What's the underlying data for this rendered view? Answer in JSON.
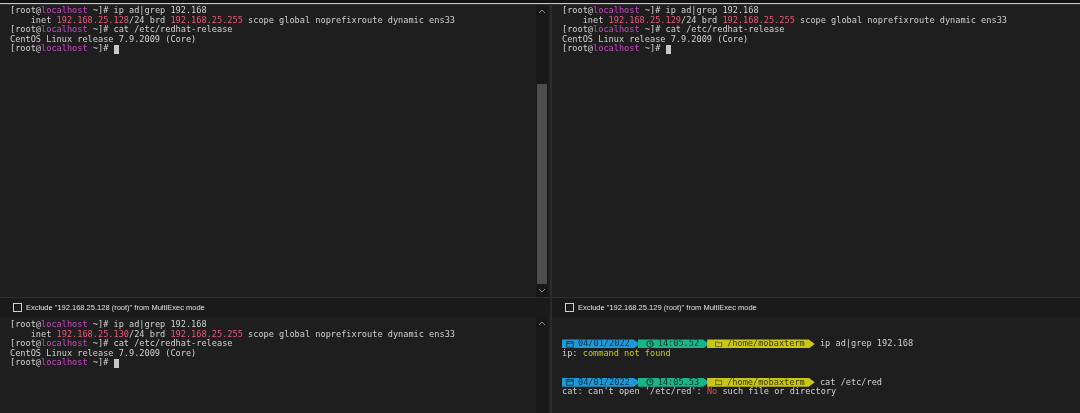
{
  "panes": [
    {
      "lines": [
        [
          {
            "kind": "plain",
            "text": "[root@"
          },
          {
            "kind": "host",
            "text": "localhost"
          },
          {
            "kind": "plain",
            "text": " ~]# ip ad|grep 192.168"
          }
        ],
        [
          {
            "kind": "plain",
            "text": "    inet "
          },
          {
            "kind": "ip",
            "text": "192.168.25.128"
          },
          {
            "kind": "plain",
            "text": "/24 brd "
          },
          {
            "kind": "ip",
            "text": "192.168.25.255"
          },
          {
            "kind": "plain",
            "text": " scope global noprefixroute dynamic ens33"
          }
        ],
        [
          {
            "kind": "plain",
            "text": "[root@"
          },
          {
            "kind": "host",
            "text": "localhost"
          },
          {
            "kind": "plain",
            "text": " ~]# cat /etc/redhat-release"
          }
        ],
        [
          {
            "kind": "plain",
            "text": "CentOS Linux release 7.9.2009 (Core)"
          }
        ],
        [
          {
            "kind": "plain",
            "text": "[root@"
          },
          {
            "kind": "host",
            "text": "localhost"
          },
          {
            "kind": "plain",
            "text": " ~]# "
          }
        ]
      ],
      "cursor": true,
      "scrollbar": true,
      "exclude": {
        "label": "Exclude \"192.168.25.128 (root)\" from MultiExec mode",
        "checked": false
      }
    },
    {
      "lines": [
        [
          {
            "kind": "plain",
            "text": "[root@"
          },
          {
            "kind": "host",
            "text": "localhost"
          },
          {
            "kind": "plain",
            "text": " ~]# ip ad|grep 192.168"
          }
        ],
        [
          {
            "kind": "plain",
            "text": "    inet "
          },
          {
            "kind": "ip",
            "text": "192.168.25.129"
          },
          {
            "kind": "plain",
            "text": "/24 brd "
          },
          {
            "kind": "ip",
            "text": "192.168.25.255"
          },
          {
            "kind": "plain",
            "text": " scope global noprefixroute dynamic ens33"
          }
        ],
        [
          {
            "kind": "plain",
            "text": "[root@"
          },
          {
            "kind": "host",
            "text": "localhost"
          },
          {
            "kind": "plain",
            "text": " ~]# cat /etc/redhat-release"
          }
        ],
        [
          {
            "kind": "plain",
            "text": "CentOS Linux release 7.9.2009 (Core)"
          }
        ],
        [
          {
            "kind": "plain",
            "text": "[root@"
          },
          {
            "kind": "host",
            "text": "localhost"
          },
          {
            "kind": "plain",
            "text": " ~]# "
          }
        ]
      ],
      "cursor": true,
      "scrollbar": false,
      "exclude": {
        "label": "Exclude \"192.168.25.129 (root)\" from MultiExec mode",
        "checked": false
      }
    },
    {
      "lines": [
        [
          {
            "kind": "plain",
            "text": "[root@"
          },
          {
            "kind": "host",
            "text": "localhost"
          },
          {
            "kind": "plain",
            "text": " ~]# ip ad|grep 192.168"
          }
        ],
        [
          {
            "kind": "plain",
            "text": "    inet "
          },
          {
            "kind": "ip",
            "text": "192.168.25.130"
          },
          {
            "kind": "plain",
            "text": "/24 brd "
          },
          {
            "kind": "ip",
            "text": "192.168.25.255"
          },
          {
            "kind": "plain",
            "text": " scope global noprefixroute dynamic ens33"
          }
        ],
        [
          {
            "kind": "plain",
            "text": "[root@"
          },
          {
            "kind": "host",
            "text": "localhost"
          },
          {
            "kind": "plain",
            "text": " ~]# cat /etc/redhat-release"
          }
        ],
        [
          {
            "kind": "plain",
            "text": "CentOS Linux release 7.9.2009 (Core)"
          }
        ],
        [
          {
            "kind": "plain",
            "text": "[root@"
          },
          {
            "kind": "host",
            "text": "localhost"
          },
          {
            "kind": "plain",
            "text": " ~]# "
          }
        ]
      ],
      "cursor": true,
      "scrollbar": true
    },
    {
      "lines": [
        [
          {
            "kind": "date",
            "text": "04/01/2022"
          },
          {
            "kind": "time",
            "text": "14:05.52"
          },
          {
            "kind": "path",
            "text": "/home/mobaxterm"
          },
          {
            "kind": "plain",
            "text": " ip ad|grep 192.168"
          }
        ],
        [
          {
            "kind": "plain",
            "text": "ip: "
          },
          {
            "kind": "warn",
            "text": "command not found"
          }
        ],
        [
          {
            "kind": "date",
            "text": "04/01/2022"
          },
          {
            "kind": "time",
            "text": "14:05.53"
          },
          {
            "kind": "path",
            "text": "/home/mobaxterm"
          },
          {
            "kind": "plain",
            "text": " cat /etc/red"
          }
        ],
        [
          {
            "kind": "plain",
            "text": "cat: can't open '/etc/red': "
          },
          {
            "kind": "error",
            "text": "No"
          },
          {
            "kind": "plain",
            "text": " such file or directory"
          }
        ]
      ],
      "cursor": false,
      "scrollbar": false
    }
  ]
}
